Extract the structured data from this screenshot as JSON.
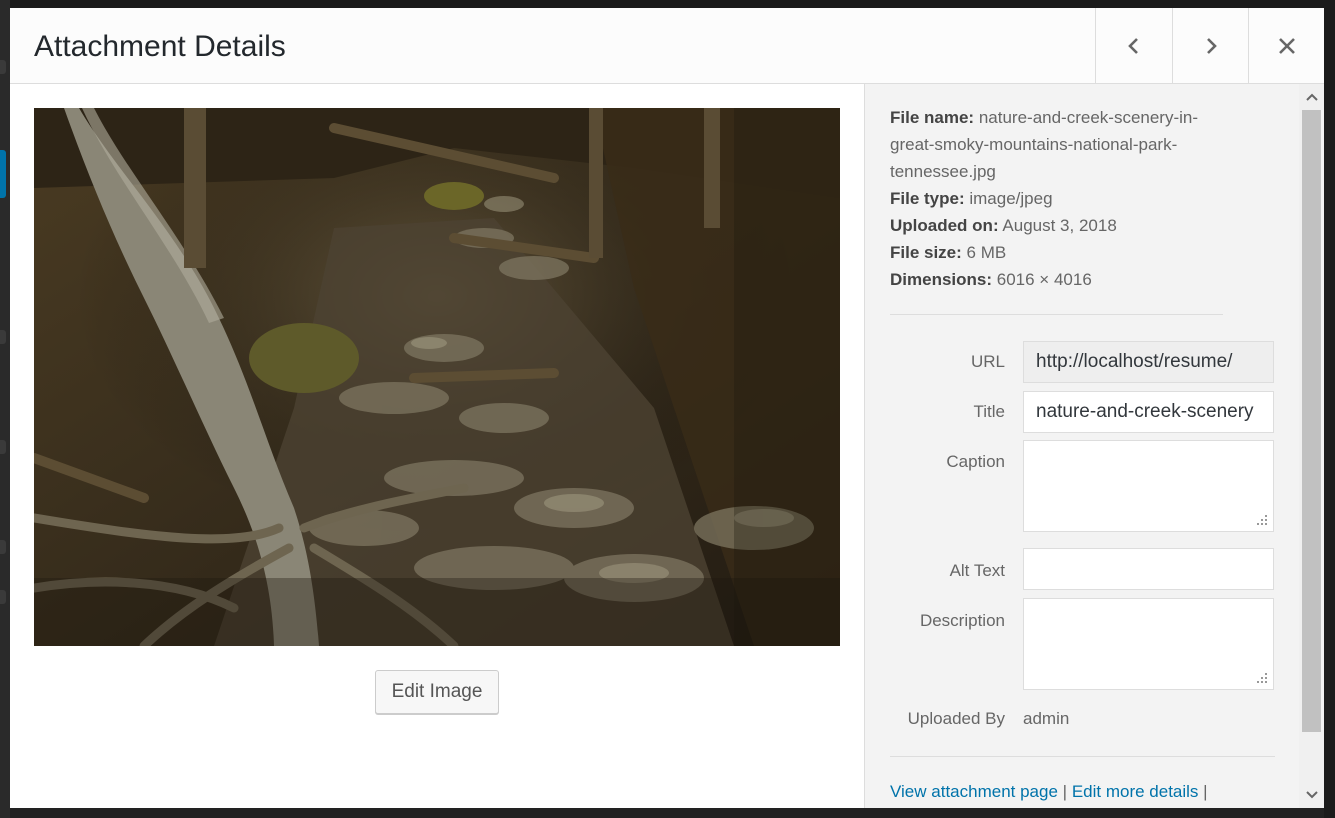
{
  "header": {
    "title": "Attachment Details",
    "prev_icon": "chevron-left-icon",
    "next_icon": "chevron-right-icon",
    "close_icon": "close-icon"
  },
  "media": {
    "image_alt": "nature-and-creek-scenery-in-great-smoky-mountains-national-park-tennessee",
    "edit_button": "Edit Image"
  },
  "details": {
    "file_name_label": "File name:",
    "file_name": "nature-and-creek-scenery-in-great-smoky-mountains-national-park-tennessee.jpg",
    "file_type_label": "File type:",
    "file_type": "image/jpeg",
    "uploaded_on_label": "Uploaded on:",
    "uploaded_on": "August 3, 2018",
    "file_size_label": "File size:",
    "file_size": "6 MB",
    "dimensions_label": "Dimensions:",
    "dimensions": "6016 × 4016"
  },
  "settings": {
    "url_label": "URL",
    "url_value": "http://localhost/resume/",
    "title_label": "Title",
    "title_value": "nature-and-creek-scenery",
    "caption_label": "Caption",
    "caption_value": "",
    "alt_label": "Alt Text",
    "alt_value": "",
    "description_label": "Description",
    "description_value": "",
    "uploaded_by_label": "Uploaded By",
    "uploaded_by_value": "admin"
  },
  "actions": {
    "view_attachment": "View attachment page",
    "separator": "|",
    "edit_more": "Edit more details",
    "trailing_separator": "|"
  },
  "colors": {
    "link": "#0073aa",
    "panel_bg": "#f3f3f3",
    "header_bg": "#fcfcfc"
  }
}
